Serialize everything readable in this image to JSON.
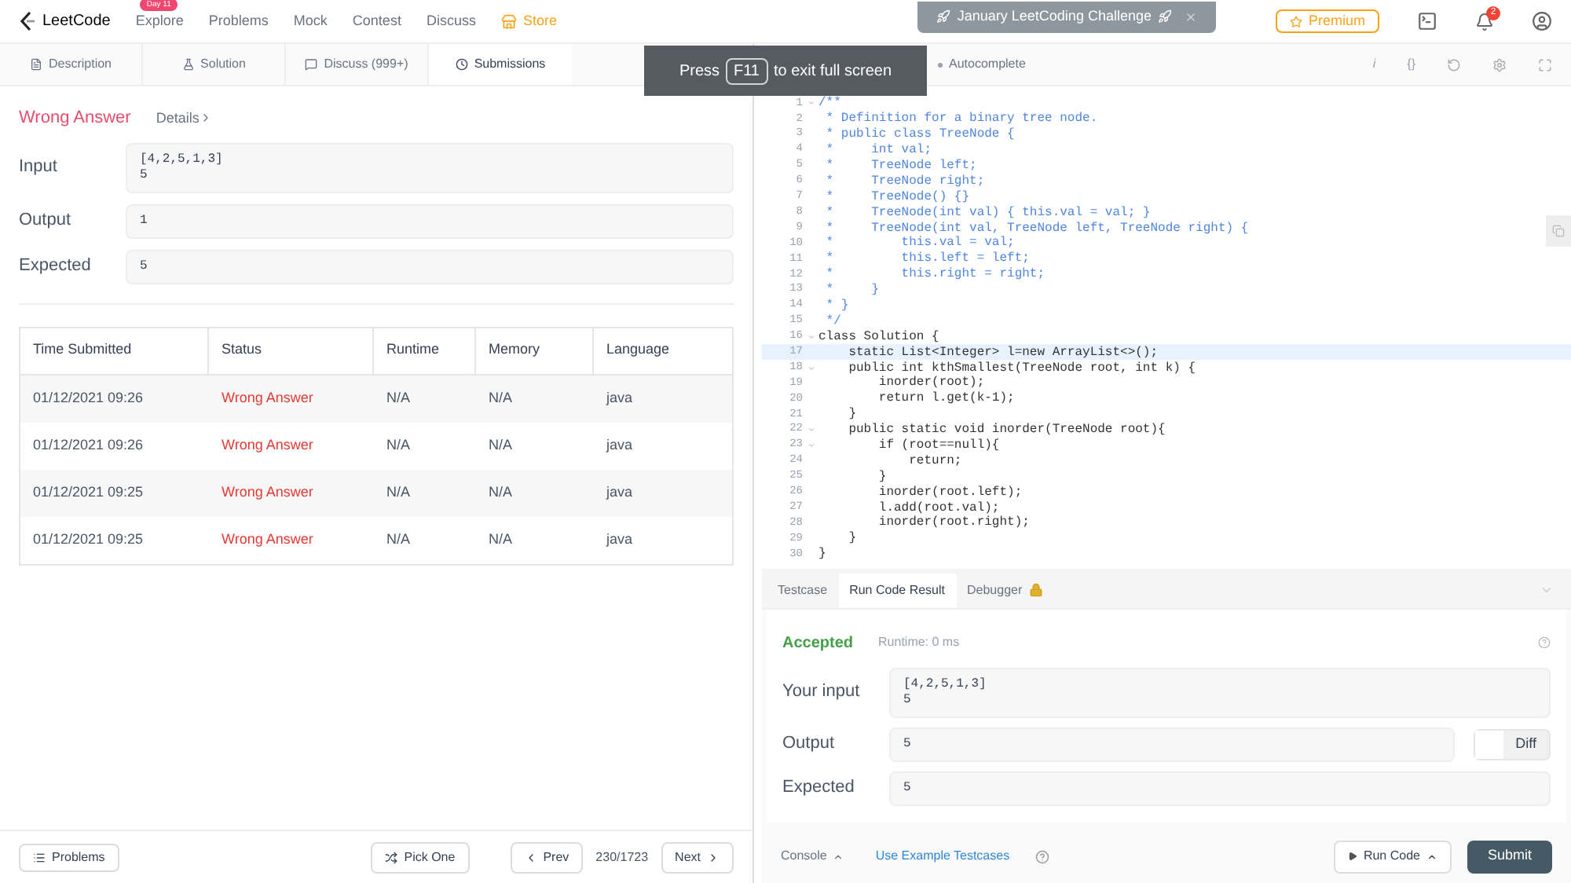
{
  "nav": {
    "logo": "LeetCode",
    "items": [
      {
        "label": "Explore",
        "badge": "Day 11",
        "kind": "plain"
      },
      {
        "label": "Problems",
        "kind": "plain"
      },
      {
        "label": "Mock",
        "kind": "plain"
      },
      {
        "label": "Contest",
        "kind": "plain"
      },
      {
        "label": "Discuss",
        "kind": "plain"
      },
      {
        "label": "Store",
        "kind": "store"
      }
    ],
    "banner": "January LeetCoding Challenge",
    "premium": "Premium",
    "notifications": "2"
  },
  "left_tabs": [
    {
      "label": "Description",
      "selected": false
    },
    {
      "label": "Solution",
      "selected": false
    },
    {
      "label": "Discuss (999+)",
      "selected": false
    },
    {
      "label": "Submissions",
      "selected": true
    }
  ],
  "result": {
    "status": "Wrong Answer",
    "details": "Details",
    "fields": [
      {
        "label": "Input",
        "lines": [
          "[4,2,5,1,3]",
          "5"
        ]
      },
      {
        "label": "Output",
        "lines": [
          "1"
        ]
      },
      {
        "label": "Expected",
        "lines": [
          "5"
        ]
      }
    ]
  },
  "table": {
    "columns": [
      "Time Submitted",
      "Status",
      "Runtime",
      "Memory",
      "Language"
    ],
    "rows": [
      [
        "01/12/2021 09:26",
        "Wrong Answer",
        "N/A",
        "N/A",
        "java"
      ],
      [
        "01/12/2021 09:26",
        "Wrong Answer",
        "N/A",
        "N/A",
        "java"
      ],
      [
        "01/12/2021 09:25",
        "Wrong Answer",
        "N/A",
        "N/A",
        "java"
      ],
      [
        "01/12/2021 09:25",
        "Wrong Answer",
        "N/A",
        "N/A",
        "java"
      ]
    ]
  },
  "fullscreen_hint": {
    "before": "Press",
    "key": "F11",
    "after": "to exit full screen"
  },
  "editor_toolbar": {
    "autocomplete": "Autocomplete",
    "info": "i",
    "braces": "{}"
  },
  "code": [
    {
      "n": "1",
      "fold": true,
      "kind": "comment",
      "text": "/**"
    },
    {
      "n": "2",
      "fold": false,
      "kind": "comment",
      "text": " * Definition for a binary tree node."
    },
    {
      "n": "3",
      "fold": false,
      "kind": "comment",
      "text": " * public class TreeNode {"
    },
    {
      "n": "4",
      "fold": false,
      "kind": "comment",
      "text": " *     int val;"
    },
    {
      "n": "5",
      "fold": false,
      "kind": "comment",
      "text": " *     TreeNode left;"
    },
    {
      "n": "6",
      "fold": false,
      "kind": "comment",
      "text": " *     TreeNode right;"
    },
    {
      "n": "7",
      "fold": false,
      "kind": "comment",
      "text": " *     TreeNode() {}"
    },
    {
      "n": "8",
      "fold": false,
      "kind": "comment",
      "text": " *     TreeNode(int val) { this.val = val; }"
    },
    {
      "n": "9",
      "fold": false,
      "kind": "comment",
      "text": " *     TreeNode(int val, TreeNode left, TreeNode right) {"
    },
    {
      "n": "10",
      "fold": false,
      "kind": "comment",
      "text": " *         this.val = val;"
    },
    {
      "n": "11",
      "fold": false,
      "kind": "comment",
      "text": " *         this.left = left;"
    },
    {
      "n": "12",
      "fold": false,
      "kind": "comment",
      "text": " *         this.right = right;"
    },
    {
      "n": "13",
      "fold": false,
      "kind": "comment",
      "text": " *     }"
    },
    {
      "n": "14",
      "fold": false,
      "kind": "comment",
      "text": " * }"
    },
    {
      "n": "15",
      "fold": false,
      "kind": "comment",
      "text": " */"
    },
    {
      "n": "16",
      "fold": true,
      "kind": "code",
      "text": "class Solution {"
    },
    {
      "n": "17",
      "fold": false,
      "kind": "code",
      "text": "    static List<Integer> l=new ArrayList<>();",
      "selected": true
    },
    {
      "n": "18",
      "fold": true,
      "kind": "code",
      "text": "    public int kthSmallest(TreeNode root, int k) {"
    },
    {
      "n": "19",
      "fold": false,
      "kind": "code",
      "text": "        inorder(root);"
    },
    {
      "n": "20",
      "fold": false,
      "kind": "code",
      "text": "        return l.get(k-1);"
    },
    {
      "n": "21",
      "fold": false,
      "kind": "code",
      "text": "    }"
    },
    {
      "n": "22",
      "fold": true,
      "kind": "code",
      "text": "    public static void inorder(TreeNode root){"
    },
    {
      "n": "23",
      "fold": true,
      "kind": "code",
      "text": "        if (root==null){"
    },
    {
      "n": "24",
      "fold": false,
      "kind": "code",
      "text": "            return;"
    },
    {
      "n": "25",
      "fold": false,
      "kind": "code",
      "text": "        }"
    },
    {
      "n": "26",
      "fold": false,
      "kind": "code",
      "text": "        inorder(root.left);"
    },
    {
      "n": "27",
      "fold": false,
      "kind": "code",
      "text": "        l.add(root.val);"
    },
    {
      "n": "28",
      "fold": false,
      "kind": "code",
      "text": "        inorder(root.right);"
    },
    {
      "n": "29",
      "fold": false,
      "kind": "code",
      "text": "    }"
    },
    {
      "n": "30",
      "fold": false,
      "kind": "code",
      "text": "}"
    }
  ],
  "console_tabs": [
    {
      "label": "Testcase",
      "selected": false,
      "locked": false
    },
    {
      "label": "Run Code Result",
      "selected": true,
      "locked": false
    },
    {
      "label": "Debugger",
      "selected": false,
      "locked": true
    }
  ],
  "run_result": {
    "status": "Accepted",
    "runtime": "Runtime: 0 ms",
    "fields": [
      {
        "label": "Your input",
        "lines": [
          "[4,2,5,1,3]",
          "5"
        ],
        "diff": false
      },
      {
        "label": "Output",
        "lines": [
          "5"
        ],
        "diff": true
      },
      {
        "label": "Expected",
        "lines": [
          "5"
        ],
        "diff": false
      }
    ],
    "diff": {
      "label": "Diff",
      "on": false
    }
  },
  "footer_left": {
    "problems": "Problems",
    "pick_one": "Pick One",
    "prev": "Prev",
    "counter": "230/1723",
    "next": "Next"
  },
  "footer_right": {
    "console": "Console",
    "example": "Use Example Testcases",
    "run": "Run Code",
    "submit": "Submit"
  }
}
